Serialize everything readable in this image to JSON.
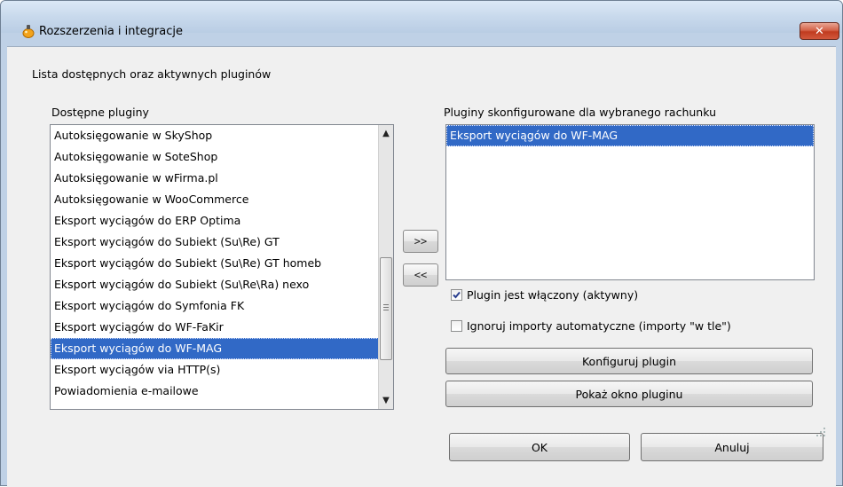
{
  "window": {
    "title": "Rozszerzenia i integracje",
    "close_label": "✕"
  },
  "section_label": "Lista dostępnych oraz aktywnych pluginów",
  "available": {
    "label": "Dostępne pluginy",
    "items": [
      "Autoksięgowanie w SkyShop",
      "Autoksięgowanie w SoteShop",
      "Autoksięgowanie w wFirma.pl",
      "Autoksięgowanie w WooCommerce",
      "Eksport wyciągów do ERP Optima",
      "Eksport wyciągów do Subiekt (Su\\Re) GT",
      "Eksport wyciągów do Subiekt (Su\\Re) GT homeb",
      "Eksport wyciągów do Subiekt (Su\\Re\\Ra) nexo",
      "Eksport wyciągów do Symfonia FK",
      "Eksport wyciągów do WF-FaKir",
      "Eksport wyciągów do WF-MAG",
      "Eksport wyciągów via HTTP(s)",
      "Powiadomienia e-mailowe"
    ],
    "selected_index": 10,
    "scroll_position": 0.78
  },
  "transfer": {
    "add_label": ">>",
    "remove_label": "<<"
  },
  "configured": {
    "label": "Pluginy skonfigurowane dla wybranego rachunku",
    "items": [
      "Eksport wyciągów do WF-MAG"
    ],
    "selected_index": 0
  },
  "options": {
    "enabled_label": "Plugin jest włączony (aktywny)",
    "enabled_checked": true,
    "ignore_label": "Ignoruj importy automatyczne (importy \"w tle\")",
    "ignore_checked": false
  },
  "actions": {
    "configure_label": "Konfiguruj plugin",
    "show_window_label": "Pokaż okno pluginu",
    "ok_label": "OK",
    "cancel_label": "Anuluj"
  },
  "colors": {
    "selection": "#3169c6",
    "titlebar": "#c8d9ec",
    "close_button": "#c13b1f"
  }
}
